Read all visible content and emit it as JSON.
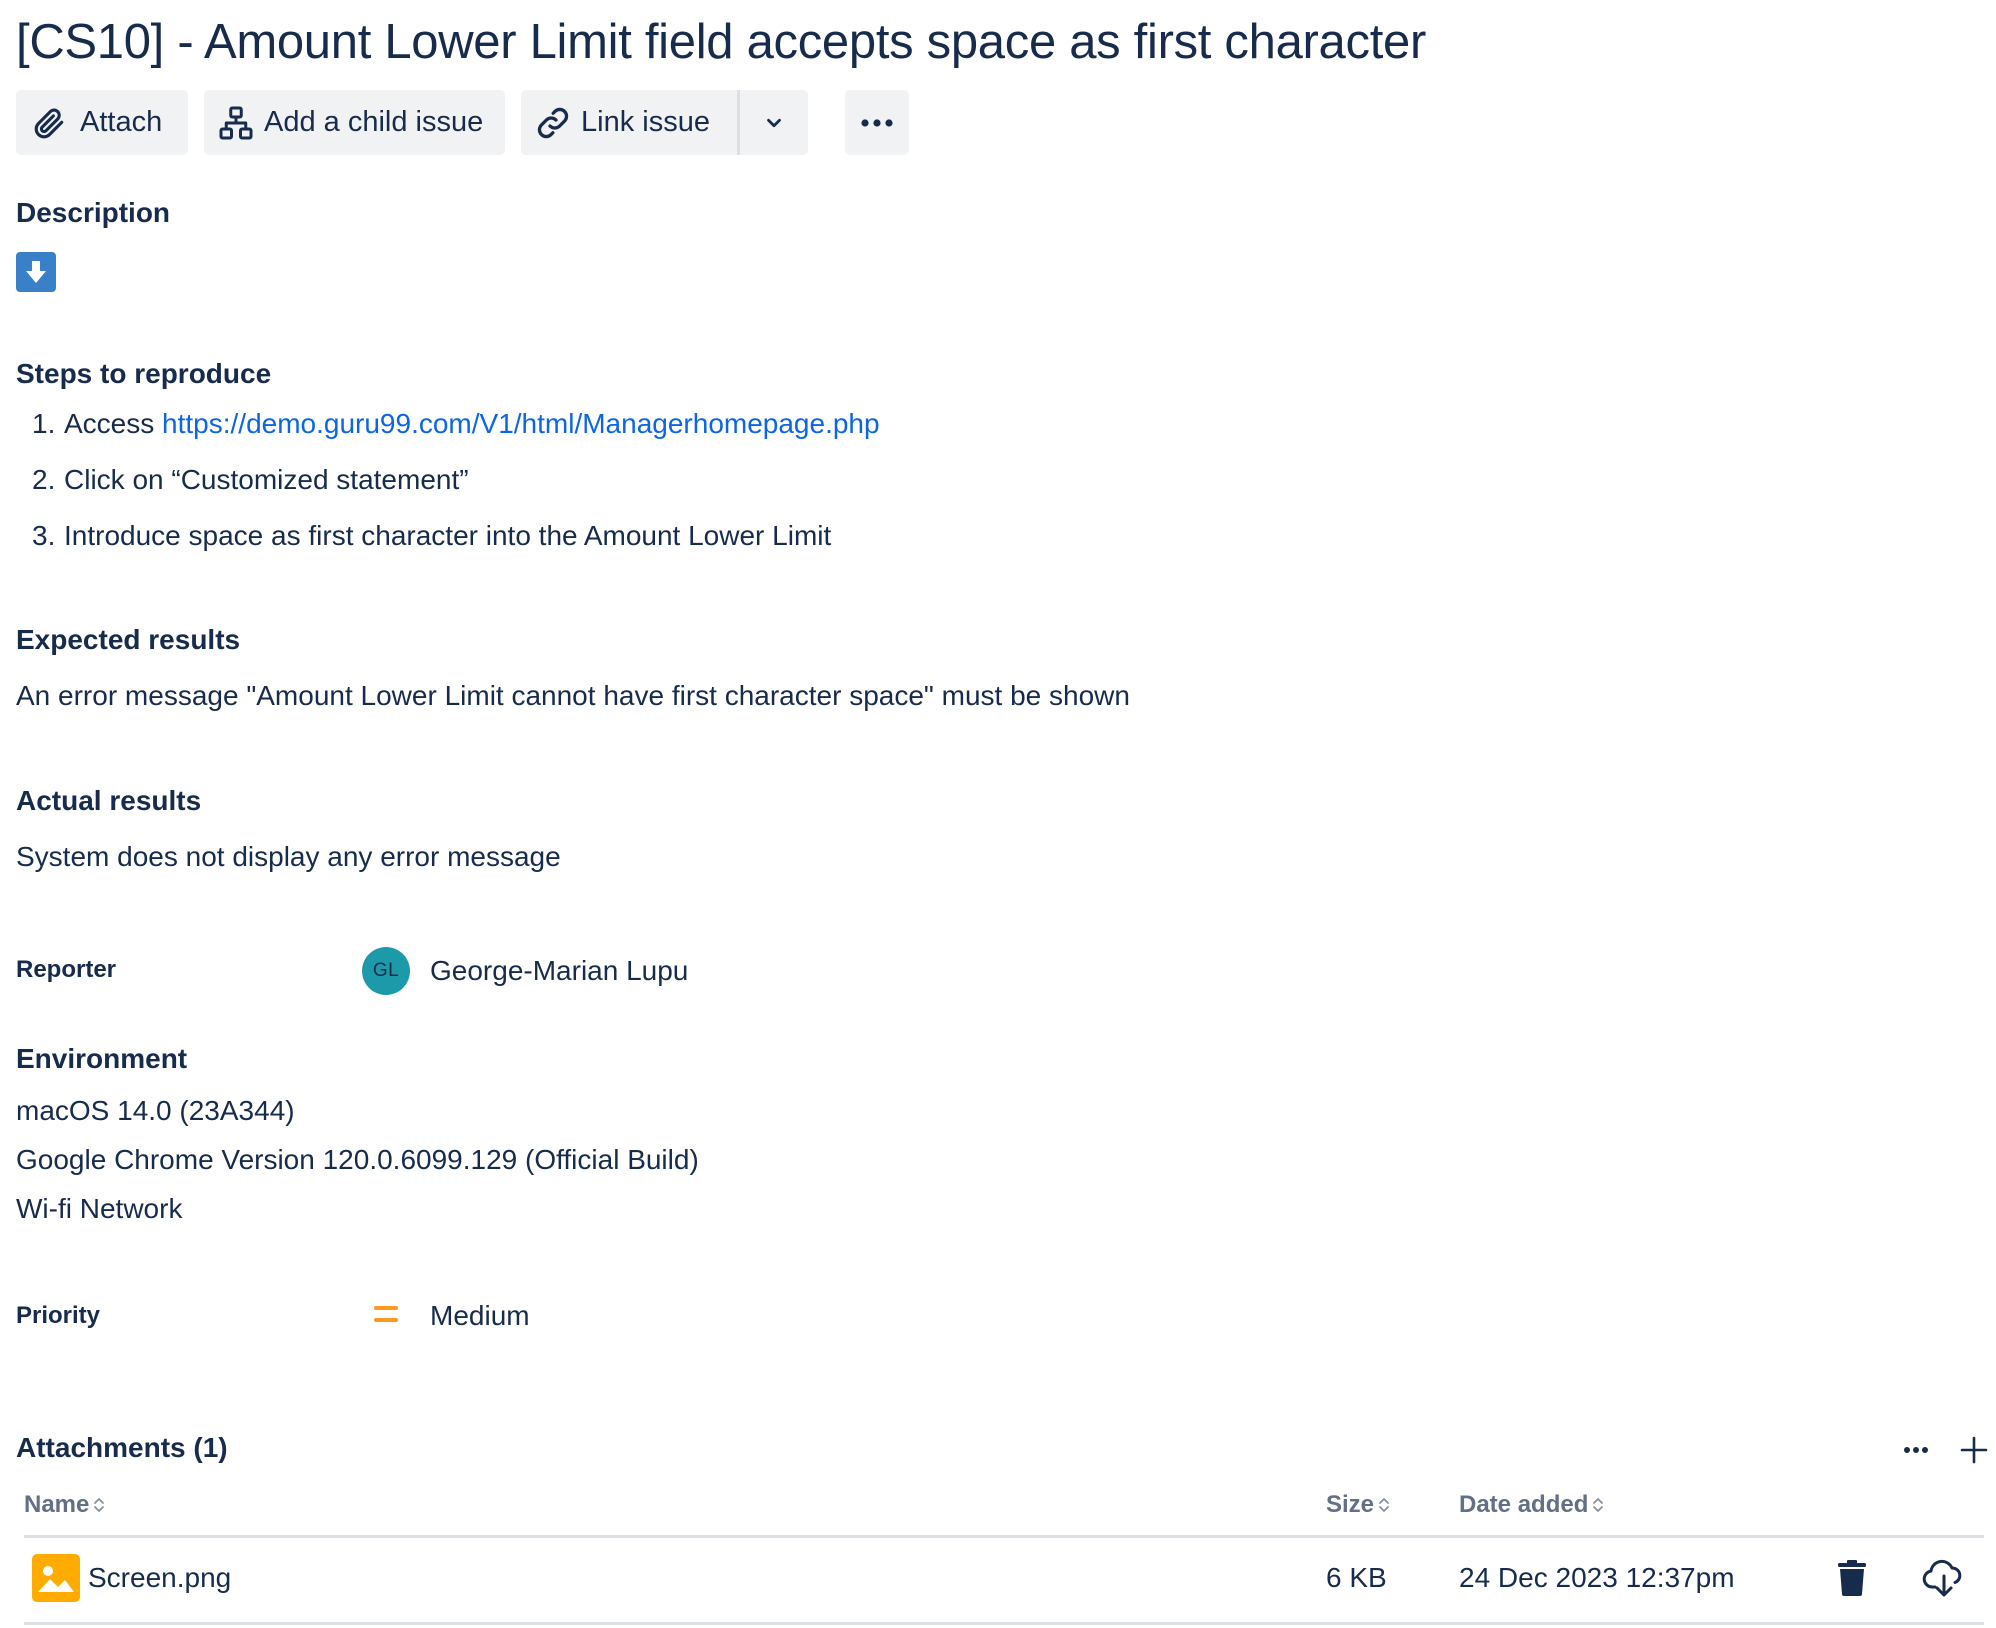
{
  "issue": {
    "title": "[CS10] - Amount Lower Limit field accepts space as first character"
  },
  "toolbar": {
    "attach_label": "Attach",
    "add_child_label": "Add a child issue",
    "link_issue_label": "Link issue"
  },
  "description": {
    "heading": "Description",
    "steps_heading": "Steps to reproduce",
    "steps": [
      {
        "num": "1.",
        "prefix": "Access ",
        "link": "https://demo.guru99.com/V1/html/Managerhomepage.php"
      },
      {
        "num": "2.",
        "text": "Click on “Customized statement”"
      },
      {
        "num": "3.",
        "text": "Introduce space as first character into the Amount Lower Limit"
      }
    ],
    "expected_heading": "Expected results",
    "expected_text": "An error message \"Amount Lower Limit cannot have first character space\" must be shown",
    "actual_heading": "Actual results",
    "actual_text": "System does not display any error message"
  },
  "reporter": {
    "label": "Reporter",
    "initials": "GL",
    "name": "George-Marian Lupu",
    "avatar_color": "#1d9aaa"
  },
  "environment": {
    "heading": "Environment",
    "lines": [
      "macOS 14.0 (23A344)",
      "Google Chrome Version 120.0.6099.129 (Official Build)",
      "Wi-fi Network"
    ]
  },
  "priority": {
    "label": "Priority",
    "value": "Medium",
    "color": "#ff991f"
  },
  "attachments": {
    "heading": "Attachments (1)",
    "columns": {
      "name": "Name",
      "size": "Size",
      "date": "Date added"
    },
    "files": [
      {
        "name": "Screen.png",
        "size": "6 KB",
        "date": "24 Dec 2023 12:37pm",
        "icon": "image-file-icon"
      }
    ]
  },
  "colors": {
    "text": "#172b4d",
    "link": "#0c66e4",
    "button_bg": "#f1f2f4",
    "subtle_text": "#626f86",
    "expand_icon_bg": "#3a80c8",
    "image_icon": "#ffab00"
  }
}
